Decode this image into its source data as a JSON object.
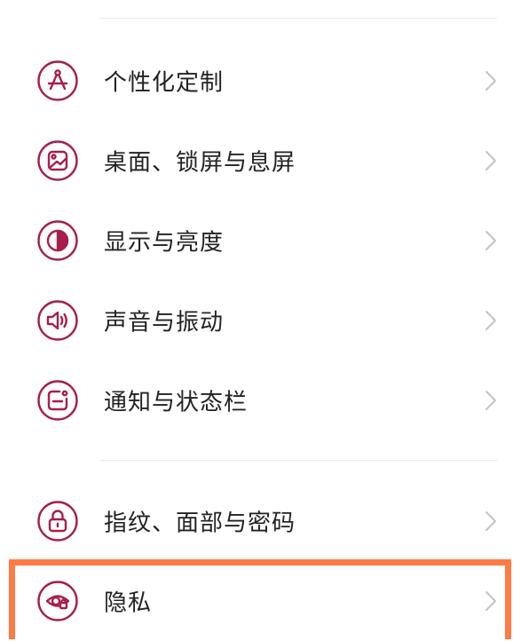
{
  "colors": {
    "accent": "#a81e4a",
    "highlight": "#ff7a45",
    "text": "#222222",
    "chevron": "#c4c4c4",
    "divider": "#e9e9e9"
  },
  "settings": {
    "items": [
      {
        "label": "个性化定制",
        "icon": "compass-icon"
      },
      {
        "label": "桌面、锁屏与息屏",
        "icon": "wallpaper-icon"
      },
      {
        "label": "显示与亮度",
        "icon": "brightness-icon"
      },
      {
        "label": "声音与振动",
        "icon": "speaker-icon"
      },
      {
        "label": "通知与状态栏",
        "icon": "notification-icon"
      },
      {
        "label": "指纹、面部与密码",
        "icon": "lock-icon"
      },
      {
        "label": "隐私",
        "icon": "privacy-eye-icon"
      }
    ]
  }
}
